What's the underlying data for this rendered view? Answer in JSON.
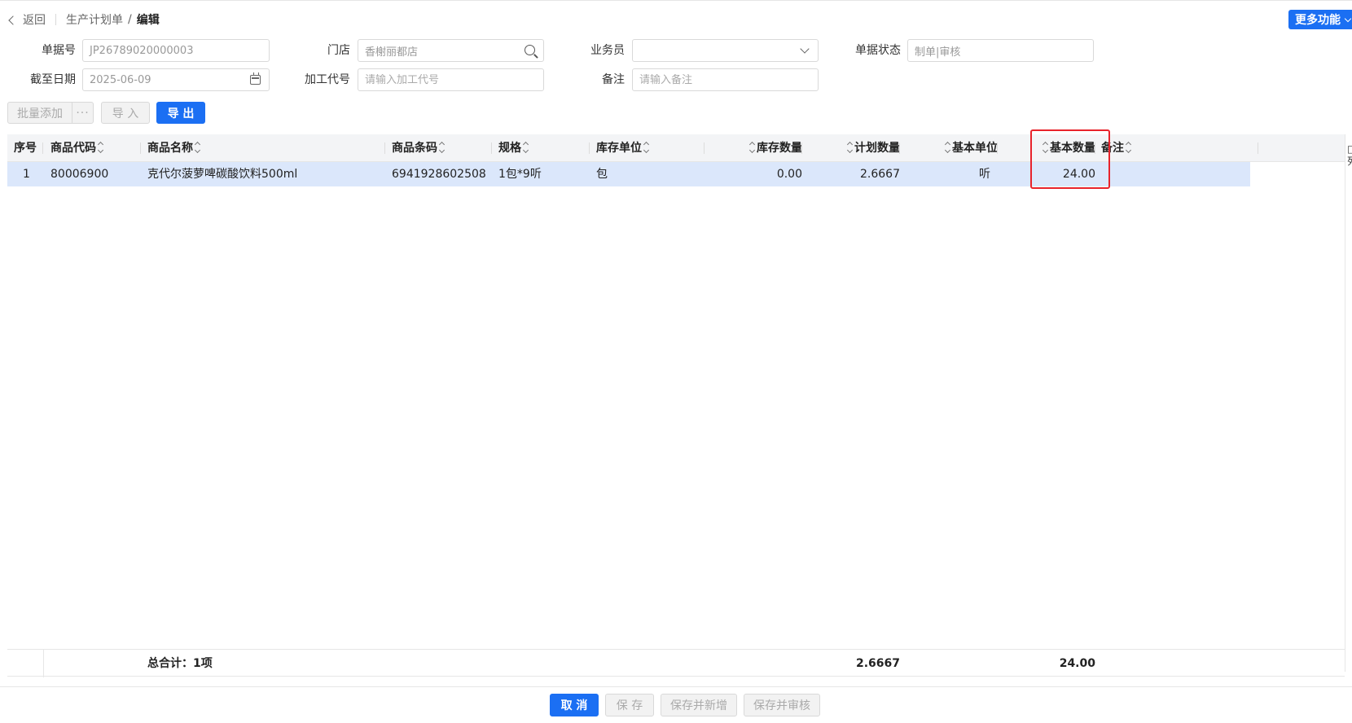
{
  "breadcrumb": {
    "back": "返回",
    "parent": "生产计划单",
    "current": "编辑"
  },
  "more_button": "更多功能",
  "form": {
    "doc_no": {
      "label": "单据号",
      "value": "JP26789020000003"
    },
    "store": {
      "label": "门店",
      "value": "香榭丽都店"
    },
    "salesman": {
      "label": "业务员",
      "value": ""
    },
    "doc_status": {
      "label": "单据状态",
      "value": "制单|审核"
    },
    "deadline": {
      "label": "截至日期",
      "value": "2025-06-09"
    },
    "process_code": {
      "label": "加工代号",
      "placeholder": "请输入加工代号"
    },
    "remark": {
      "label": "备注",
      "placeholder": "请输入备注"
    }
  },
  "toolbar": {
    "batch_add": "批量添加",
    "more": "···",
    "import": "导 入",
    "export": "导 出"
  },
  "table": {
    "columns": {
      "seq": "序号",
      "code": "商品代码",
      "name": "商品名称",
      "barcode": "商品条码",
      "spec": "规格",
      "stock_unit": "库存单位",
      "stock_qty": "库存数量",
      "plan_qty": "计划数量",
      "base_unit": "基本单位",
      "base_qty": "基本数量",
      "remark": "备注"
    },
    "rows": [
      {
        "seq": "1",
        "code": "80006900",
        "name": "克代尔菠萝啤碳酸饮料500ml",
        "barcode": "6941928602508",
        "spec": "1包*9听",
        "stock_unit": "包",
        "stock_qty": "0.00",
        "plan_qty": "2.6667",
        "base_unit": "听",
        "base_qty": "24.00",
        "remark": ""
      }
    ],
    "totals": {
      "label": "总合计：1项",
      "plan_qty": "2.6667",
      "base_qty": "24.00"
    }
  },
  "edge_text": "□ 列",
  "footer": {
    "cancel": "取 消",
    "save": "保 存",
    "save_new": "保存并新增",
    "save_audit": "保存并审核"
  },
  "colors": {
    "primary": "#1b6ff3",
    "highlight": "#e8232b",
    "row_selected": "#dbe7fb"
  }
}
